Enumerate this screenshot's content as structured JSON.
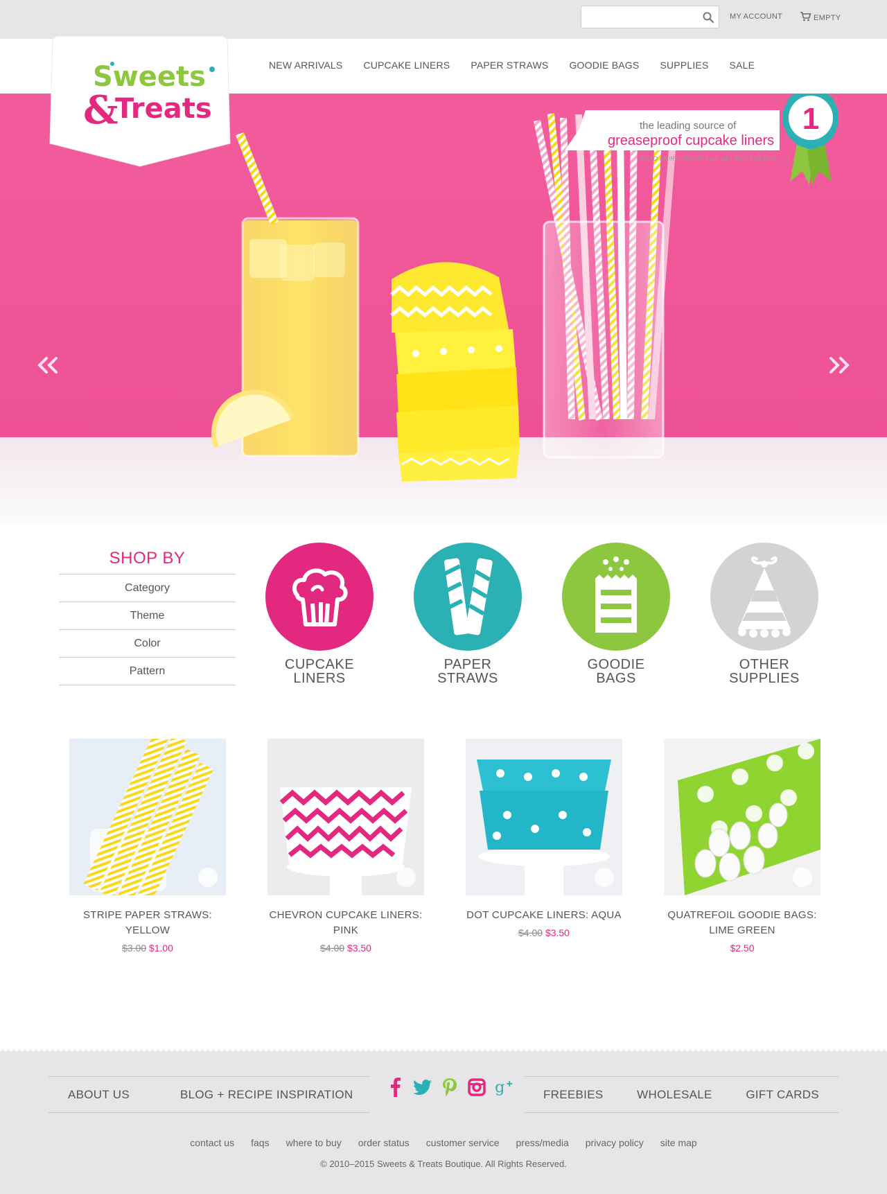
{
  "topbar": {
    "search_value": "",
    "search_placeholder": "",
    "my_account": "MY ACCOUNT",
    "cart_label": "EMPTY"
  },
  "brand": {
    "logo_line1": "Sweets",
    "logo_amp": "&",
    "logo_line2": "Treats",
    "colors": {
      "pink": "#e3287f",
      "teal": "#2bb0b4",
      "lime": "#8dc63f",
      "gray": "#d3d3d5"
    }
  },
  "nav": {
    "items": [
      "NEW ARRIVALS",
      "CUPCAKE LINERS",
      "PAPER STRAWS",
      "GOODIE BAGS",
      "SUPPLIES",
      "SALE"
    ]
  },
  "hero": {
    "tagline_small": "the leading source of",
    "tagline_big": "greaseproof cupcake liners",
    "read_more": "READ MORE ABOUT THE S&T DIFFERENCE »",
    "award_number": "1",
    "prev_icon": "double-chevron-left-icon",
    "next_icon": "double-chevron-right-icon"
  },
  "shop_by": {
    "title": "SHOP BY",
    "items": [
      "Category",
      "Theme",
      "Color",
      "Pattern"
    ]
  },
  "categories": [
    {
      "line1": "CUPCAKE",
      "line2": "LINERS",
      "color": "#e3287f",
      "icon": "cupcake-icon"
    },
    {
      "line1": "PAPER",
      "line2": "STRAWS",
      "color": "#2bb0b4",
      "icon": "straws-icon"
    },
    {
      "line1": "GOODIE",
      "line2": "BAGS",
      "color": "#8dc63f",
      "icon": "goodie-bag-icon"
    },
    {
      "line1": "OTHER",
      "line2": "SUPPLIES",
      "color": "#d3d3d5",
      "icon": "party-hat-icon"
    }
  ],
  "products": [
    {
      "name_line1": "STRIPE PAPER STRAWS:",
      "name_line2": "YELLOW",
      "old_price": "$3.00",
      "price": "$1.00"
    },
    {
      "name_line1": "CHEVRON CUPCAKE LINERS:",
      "name_line2": "PINK",
      "old_price": "$4.00",
      "price": "$3.50"
    },
    {
      "name_line1": "DOT CUPCAKE LINERS: AQUA",
      "name_line2": "",
      "old_price": "$4.00",
      "price": "$3.50"
    },
    {
      "name_line1": "QUATREFOIL GOODIE BAGS:",
      "name_line2": "LIME GREEN",
      "old_price": "",
      "price": "$2.50"
    }
  ],
  "footer": {
    "left_links": [
      "ABOUT US",
      "BLOG + RECIPE INSPIRATION"
    ],
    "right_links": [
      "FREEBIES",
      "WHOLESALE",
      "GIFT CARDS"
    ],
    "social": [
      "facebook-icon",
      "twitter-icon",
      "pinterest-icon",
      "instagram-icon",
      "google-plus-icon"
    ],
    "small_links": [
      "contact us",
      "faqs",
      "where to buy",
      "order status",
      "customer service",
      "press/media",
      "privacy policy",
      "site map"
    ],
    "copyright": "© 2010–2015 Sweets & Treats Boutique. All Rights Reserved."
  }
}
